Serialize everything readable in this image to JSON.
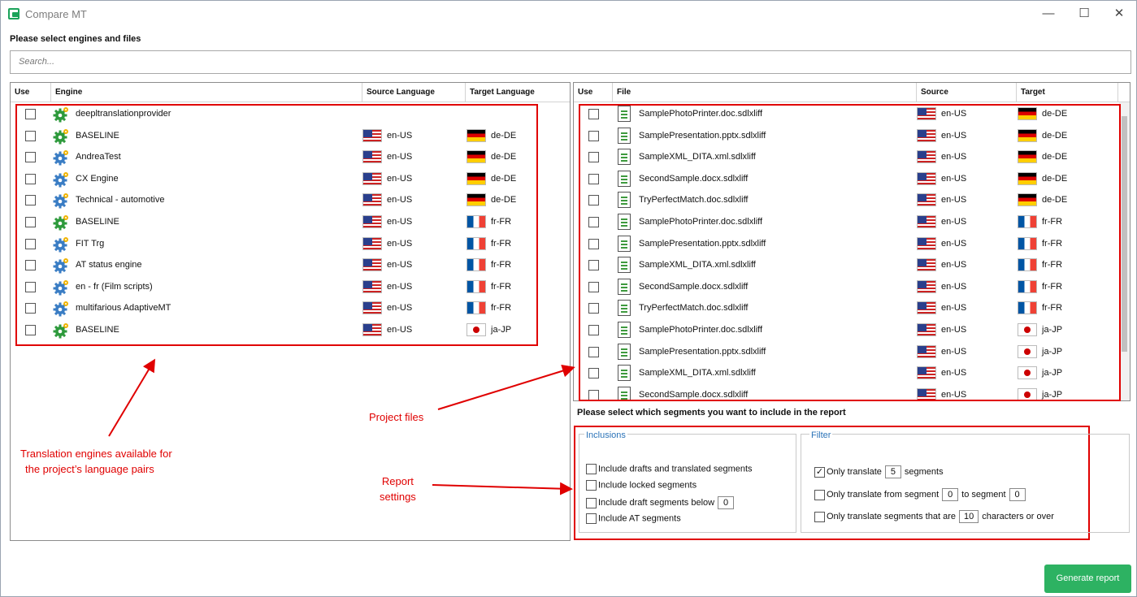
{
  "window": {
    "title": "Compare MT",
    "minimize": "—",
    "maximize": "☐",
    "close": "✕"
  },
  "heading": "Please select engines and files",
  "search": {
    "placeholder": "Search..."
  },
  "engines": {
    "columns": [
      "Use",
      "Engine",
      "Source Language",
      "Target Language"
    ],
    "rows": [
      {
        "name": "deepltranslationprovider",
        "source": "",
        "source_flag": "",
        "target": "",
        "target_flag": "",
        "icon": "green-gear-icon"
      },
      {
        "name": "BASELINE",
        "source": "en-US",
        "source_flag": "us",
        "target": "de-DE",
        "target_flag": "de",
        "icon": "green-gear-icon"
      },
      {
        "name": "AndreaTest",
        "source": "en-US",
        "source_flag": "us",
        "target": "de-DE",
        "target_flag": "de",
        "icon": "blue-gear-icon"
      },
      {
        "name": "CX Engine",
        "source": "en-US",
        "source_flag": "us",
        "target": "de-DE",
        "target_flag": "de",
        "icon": "blue-gear-icon"
      },
      {
        "name": "Technical - automotive",
        "source": "en-US",
        "source_flag": "us",
        "target": "de-DE",
        "target_flag": "de",
        "icon": "blue-gear-icon"
      },
      {
        "name": "BASELINE",
        "source": "en-US",
        "source_flag": "us",
        "target": "fr-FR",
        "target_flag": "fr",
        "icon": "green-gear-icon"
      },
      {
        "name": "FIT Trg",
        "source": "en-US",
        "source_flag": "us",
        "target": "fr-FR",
        "target_flag": "fr",
        "icon": "blue-gear-icon"
      },
      {
        "name": "AT status engine",
        "source": "en-US",
        "source_flag": "us",
        "target": "fr-FR",
        "target_flag": "fr",
        "icon": "blue-gear-icon"
      },
      {
        "name": "en - fr (Film scripts)",
        "source": "en-US",
        "source_flag": "us",
        "target": "fr-FR",
        "target_flag": "fr",
        "icon": "blue-gear-icon"
      },
      {
        "name": "multifarious AdaptiveMT",
        "source": "en-US",
        "source_flag": "us",
        "target": "fr-FR",
        "target_flag": "fr",
        "icon": "blue-gear-icon"
      },
      {
        "name": "BASELINE",
        "source": "en-US",
        "source_flag": "us",
        "target": "ja-JP",
        "target_flag": "jp",
        "icon": "green-gear-icon"
      }
    ]
  },
  "files": {
    "columns": [
      "Use",
      "File",
      "Source",
      "Target"
    ],
    "rows": [
      {
        "name": "SamplePhotoPrinter.doc.sdlxliff",
        "source": "en-US",
        "source_flag": "us",
        "target": "de-DE",
        "target_flag": "de"
      },
      {
        "name": "SamplePresentation.pptx.sdlxliff",
        "source": "en-US",
        "source_flag": "us",
        "target": "de-DE",
        "target_flag": "de"
      },
      {
        "name": "SampleXML_DITA.xml.sdlxliff",
        "source": "en-US",
        "source_flag": "us",
        "target": "de-DE",
        "target_flag": "de"
      },
      {
        "name": "SecondSample.docx.sdlxliff",
        "source": "en-US",
        "source_flag": "us",
        "target": "de-DE",
        "target_flag": "de"
      },
      {
        "name": "TryPerfectMatch.doc.sdlxliff",
        "source": "en-US",
        "source_flag": "us",
        "target": "de-DE",
        "target_flag": "de"
      },
      {
        "name": "SamplePhotoPrinter.doc.sdlxliff",
        "source": "en-US",
        "source_flag": "us",
        "target": "fr-FR",
        "target_flag": "fr"
      },
      {
        "name": "SamplePresentation.pptx.sdlxliff",
        "source": "en-US",
        "source_flag": "us",
        "target": "fr-FR",
        "target_flag": "fr"
      },
      {
        "name": "SampleXML_DITA.xml.sdlxliff",
        "source": "en-US",
        "source_flag": "us",
        "target": "fr-FR",
        "target_flag": "fr"
      },
      {
        "name": "SecondSample.docx.sdlxliff",
        "source": "en-US",
        "source_flag": "us",
        "target": "fr-FR",
        "target_flag": "fr"
      },
      {
        "name": "TryPerfectMatch.doc.sdlxliff",
        "source": "en-US",
        "source_flag": "us",
        "target": "fr-FR",
        "target_flag": "fr"
      },
      {
        "name": "SamplePhotoPrinter.doc.sdlxliff",
        "source": "en-US",
        "source_flag": "us",
        "target": "ja-JP",
        "target_flag": "jp"
      },
      {
        "name": "SamplePresentation.pptx.sdlxliff",
        "source": "en-US",
        "source_flag": "us",
        "target": "ja-JP",
        "target_flag": "jp"
      },
      {
        "name": "SampleXML_DITA.xml.sdlxliff",
        "source": "en-US",
        "source_flag": "us",
        "target": "ja-JP",
        "target_flag": "jp"
      },
      {
        "name": "SecondSample.docx.sdlxliff",
        "source": "en-US",
        "source_flag": "us",
        "target": "ja-JP",
        "target_flag": "jp"
      }
    ]
  },
  "annotations": {
    "engines_line1": "Translation engines available for",
    "engines_line2": "the project’s language pairs",
    "project_files": "Project files",
    "report_line1": "Report",
    "report_line2": "settings"
  },
  "segments": {
    "heading": "Please select which segments you want to include in the report",
    "inclusions": {
      "label": "Inclusions",
      "drafts_translated": "Include drafts and translated segments",
      "locked": "Include locked segments",
      "draft_below": "Include draft segments below",
      "draft_below_value": "0",
      "at": "Include AT segments"
    },
    "filter": {
      "label": "Filter",
      "only_translate": "Only translate",
      "only_translate_value": "5",
      "only_translate_suffix": "segments",
      "only_translate_checked": true,
      "from_segment": "Only translate from segment",
      "from_value": "0",
      "to_label": "to segment",
      "to_value": "0",
      "chars": "Only translate segments that are",
      "chars_value": "10",
      "chars_suffix": "characters or over"
    }
  },
  "generate_button": "Generate report"
}
